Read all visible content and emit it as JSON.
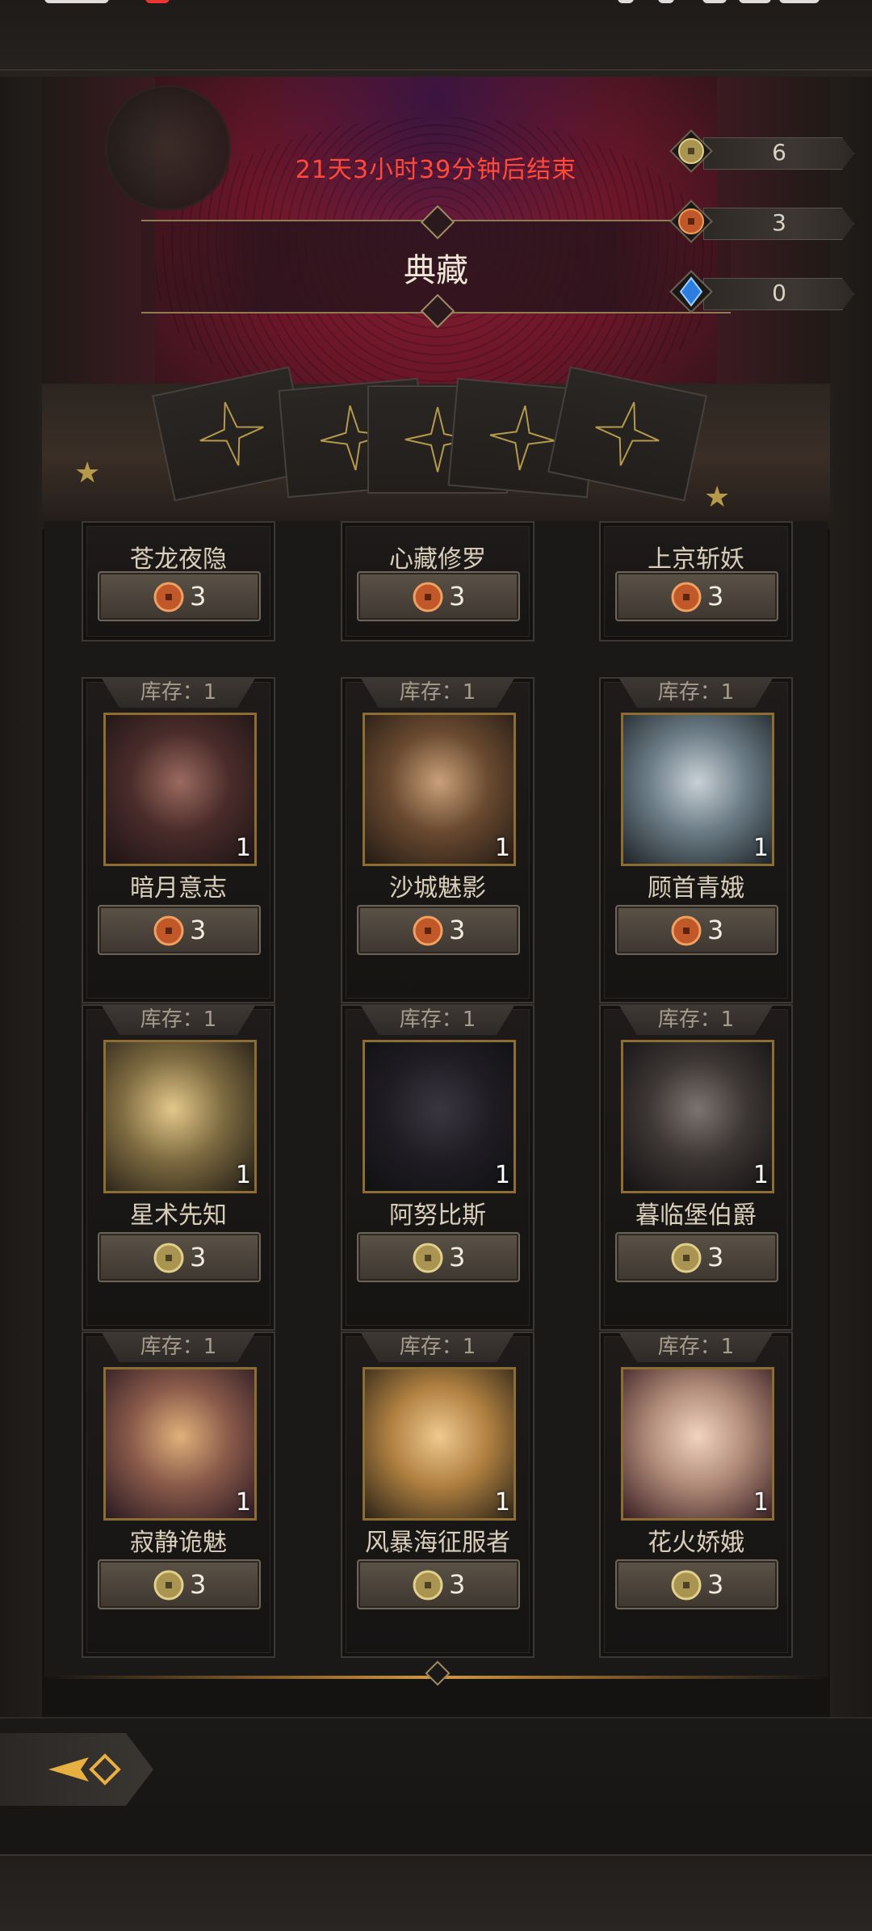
{
  "event": {
    "countdown": "21天3小时39分钟后结束",
    "title": "典藏"
  },
  "currencies": [
    {
      "icon": "gold-coin-icon",
      "value": "6"
    },
    {
      "icon": "bronze-coin-icon",
      "value": "3"
    },
    {
      "icon": "blue-crystal-icon",
      "value": "0"
    }
  ],
  "shop": {
    "partial_row": [
      {
        "name": "苍龙夜隐",
        "price": "3",
        "coin": "bronze-coin-icon"
      },
      {
        "name": "心藏修罗",
        "price": "3",
        "coin": "bronze-coin-icon"
      },
      {
        "name": "上京斩妖",
        "price": "3",
        "coin": "bronze-coin-icon"
      }
    ],
    "items": [
      {
        "stock": "库存：1",
        "qty": "1",
        "name": "暗月意志",
        "price": "3",
        "coin": "bronze-coin-icon"
      },
      {
        "stock": "库存：1",
        "qty": "1",
        "name": "沙城魅影",
        "price": "3",
        "coin": "bronze-coin-icon"
      },
      {
        "stock": "库存：1",
        "qty": "1",
        "name": "顾首青娥",
        "price": "3",
        "coin": "bronze-coin-icon"
      },
      {
        "stock": "库存：1",
        "qty": "1",
        "name": "星术先知",
        "price": "3",
        "coin": "gold-coin-icon"
      },
      {
        "stock": "库存：1",
        "qty": "1",
        "name": "阿努比斯",
        "price": "3",
        "coin": "gold-coin-icon"
      },
      {
        "stock": "库存：1",
        "qty": "1",
        "name": "暮临堡伯爵",
        "price": "3",
        "coin": "gold-coin-icon"
      },
      {
        "stock": "库存：1",
        "qty": "1",
        "name": "寂静诡魅",
        "price": "3",
        "coin": "gold-coin-icon"
      },
      {
        "stock": "库存：1",
        "qty": "1",
        "name": "风暴海征服者",
        "price": "3",
        "coin": "gold-coin-icon"
      },
      {
        "stock": "库存：1",
        "qty": "1",
        "name": "花火娇娥",
        "price": "3",
        "coin": "gold-coin-icon"
      }
    ]
  },
  "colors": {
    "countdown": "#ff4a3a",
    "gold_frame": "#8c6d32",
    "background": "#151312"
  }
}
